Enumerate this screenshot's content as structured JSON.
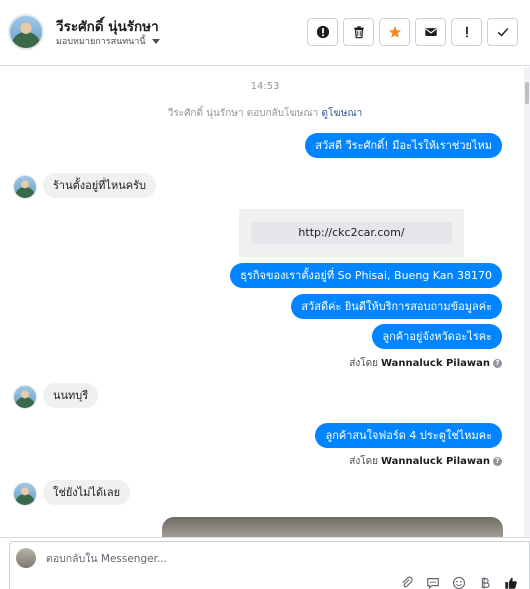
{
  "header": {
    "contact_name": "วีระศักดิ์ นุ่นรักษา",
    "assign_label": "มอบหมายการสนทนานี้"
  },
  "actions": {
    "icons": [
      "alert-circle-icon",
      "trash-icon",
      "star-icon",
      "envelope-icon",
      "exclamation-icon",
      "check-icon"
    ],
    "star_color": "#f28b1e"
  },
  "chat": {
    "time": "14:53",
    "reply_note": {
      "prefix": "วีระศักดิ์ นุ่นรักษา ตอบกลับโฆษณา",
      "link": "ดูโฆษณา"
    },
    "messages": [
      {
        "from": "page",
        "text": "สวัสดี วีระศักดิ์! มีอะไรให้เราช่วยไหม"
      },
      {
        "from": "customer",
        "text": "ร้านตั้งอยู่ที่ไหนครับ"
      },
      {
        "from": "page",
        "type": "link",
        "text": "http://ckc2car.com/"
      },
      {
        "from": "page",
        "text": "ธุรกิจของเราตั้งอยู่ที่ So Phisai, Bueng Kan 38170"
      },
      {
        "from": "page",
        "text": "สวัสดีค่ะ  ยินดีให้บริการสอบถามข้อมูลค่ะ"
      },
      {
        "from": "page",
        "text": "ลูกค้าอยู่จังหวัดอะไรคะ"
      },
      {
        "from": "customer",
        "text": "นนทบุรี"
      },
      {
        "from": "page",
        "text": "ลูกค้าสนใจฟอร์ด 4 ประตูใช่ไหมคะ"
      },
      {
        "from": "customer",
        "text": "ใช่ยังไม่ได้เลย"
      }
    ],
    "sent_by_label": "ส่งโดย",
    "sent_by_name": "Wannaluck Pilawan"
  },
  "composer": {
    "placeholder": "ตอบกลับใน Messenger...",
    "accent": "#0084ff"
  }
}
